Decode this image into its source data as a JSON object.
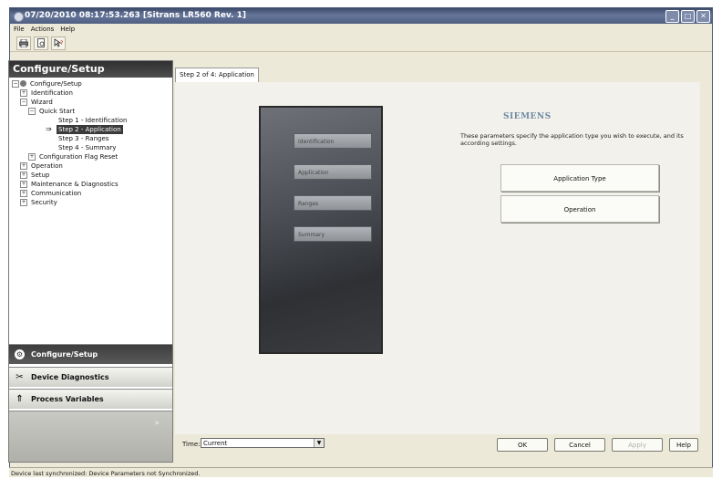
{
  "window": {
    "title": "07/20/2010 08:17:53.263 [Sitrans LR560 Rev. 1]",
    "controls": {
      "minimize": "_",
      "maximize": "□",
      "close": "✕"
    }
  },
  "menu": {
    "items": [
      "File",
      "Actions",
      "Help"
    ]
  },
  "toolbar": {
    "icons": [
      "printer-icon",
      "print-preview-icon",
      "help-pointer-icon"
    ]
  },
  "left_panel": {
    "header": "Configure/Setup",
    "tree": [
      {
        "label": "Configure/Setup",
        "depth": 0,
        "expander": "−",
        "selected": false
      },
      {
        "label": "Identification",
        "depth": 1,
        "expander": "+",
        "selected": false
      },
      {
        "label": "Wizard",
        "depth": 1,
        "expander": "−",
        "selected": false
      },
      {
        "label": "Quick Start",
        "depth": 2,
        "expander": "−",
        "selected": false
      },
      {
        "label": "Step 1 - Identification",
        "depth": 3,
        "expander": "",
        "selected": false
      },
      {
        "label": "Step 2 - Application",
        "depth": 3,
        "expander": "",
        "selected": true
      },
      {
        "label": "Step 3 - Ranges",
        "depth": 3,
        "expander": "",
        "selected": false
      },
      {
        "label": "Step 4 - Summary",
        "depth": 3,
        "expander": "",
        "selected": false
      },
      {
        "label": "Configuration Flag Reset",
        "depth": 2,
        "expander": "+",
        "selected": false
      },
      {
        "label": "Operation",
        "depth": 1,
        "expander": "+",
        "selected": false
      },
      {
        "label": "Setup",
        "depth": 1,
        "expander": "+",
        "selected": false
      },
      {
        "label": "Maintenance & Diagnostics",
        "depth": 1,
        "expander": "+",
        "selected": false
      },
      {
        "label": "Communication",
        "depth": 1,
        "expander": "+",
        "selected": false
      },
      {
        "label": "Security",
        "depth": 1,
        "expander": "+",
        "selected": false
      }
    ],
    "nav": {
      "configure": "Configure/Setup",
      "diagnostics": "Device Diagnostics",
      "process": "Process Variables"
    }
  },
  "tab": {
    "label": "Step 2 of 4: Application"
  },
  "wizard_image": {
    "steps": [
      "Identification",
      "Application",
      "Ranges",
      "Summary"
    ]
  },
  "content": {
    "brand": "SIEMENS",
    "description": "These parameters specify the application type you wish to execute, and its according settings.",
    "buttons": {
      "application_type": "Application Type",
      "operation": "Operation"
    }
  },
  "bottom": {
    "time_label": "Time:",
    "time_value": "Current",
    "ok": "OK",
    "cancel": "Cancel",
    "apply": "Apply",
    "help": "Help"
  },
  "status": "Device last synchronized: Device Parameters not Synchronized."
}
